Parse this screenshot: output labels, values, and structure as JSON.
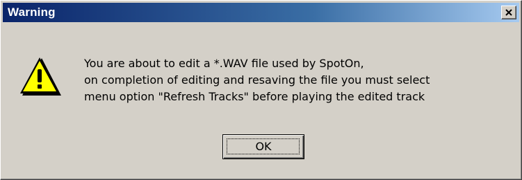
{
  "window": {
    "title": "Warning",
    "colors": {
      "titlebar_start": "#0a246a",
      "titlebar_end": "#a6caf0",
      "face": "#d4d0c8"
    }
  },
  "icons": {
    "close": "close-icon",
    "warning": "warning-icon"
  },
  "message": {
    "lines": [
      "You are about to edit a *.WAV file used by SpotOn,",
      "on completion of editing and resaving the file you must select",
      "menu option \"Refresh Tracks\" before playing the edited track"
    ]
  },
  "buttons": {
    "ok_label": "OK"
  }
}
